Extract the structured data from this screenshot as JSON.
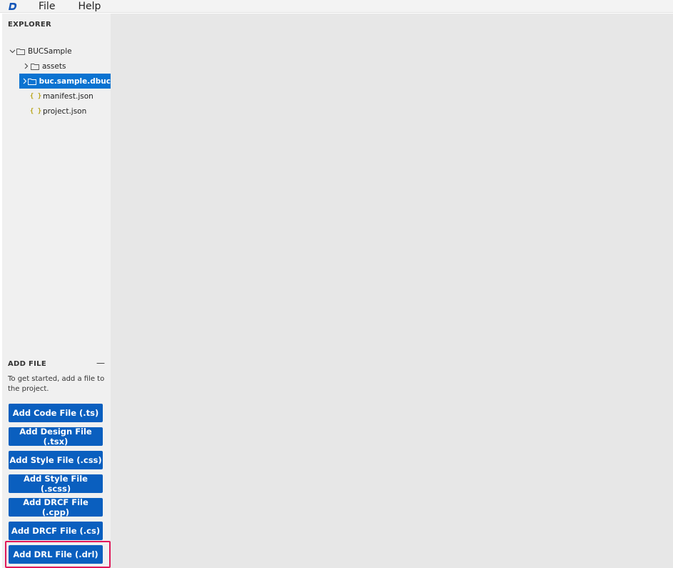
{
  "menubar": {
    "logo_icon": "d-logo-icon",
    "items": [
      {
        "label": "File"
      },
      {
        "label": "Help"
      }
    ]
  },
  "explorer": {
    "title": "EXPLORER",
    "tree": {
      "root": {
        "label": "BUCSample",
        "expanded": true
      },
      "children": [
        {
          "label": "assets",
          "type": "folder"
        },
        {
          "label": "buc.sample.dbuc",
          "type": "folder",
          "selected": true
        },
        {
          "label": "manifest.json",
          "type": "json",
          "icon_glyph": "{ }"
        },
        {
          "label": "project.json",
          "type": "json",
          "icon_glyph": "{ }"
        }
      ]
    }
  },
  "add_file": {
    "title": "ADD FILE",
    "collapse_glyph": "—",
    "description": "To get started, add a file to the project.",
    "buttons": [
      {
        "label": "Add Code File (.ts)"
      },
      {
        "label": "Add Design File (.tsx)"
      },
      {
        "label": "Add Style File (.css)"
      },
      {
        "label": "Add Style File (.scss)"
      },
      {
        "label": "Add DRCF File (.cpp)"
      },
      {
        "label": "Add DRCF File (.cs)"
      },
      {
        "label": "Add DRL File (.drl)"
      }
    ]
  },
  "colors": {
    "accent": "#0a5fbf",
    "selection": "#0a73d1",
    "highlight": "#e0195a"
  }
}
